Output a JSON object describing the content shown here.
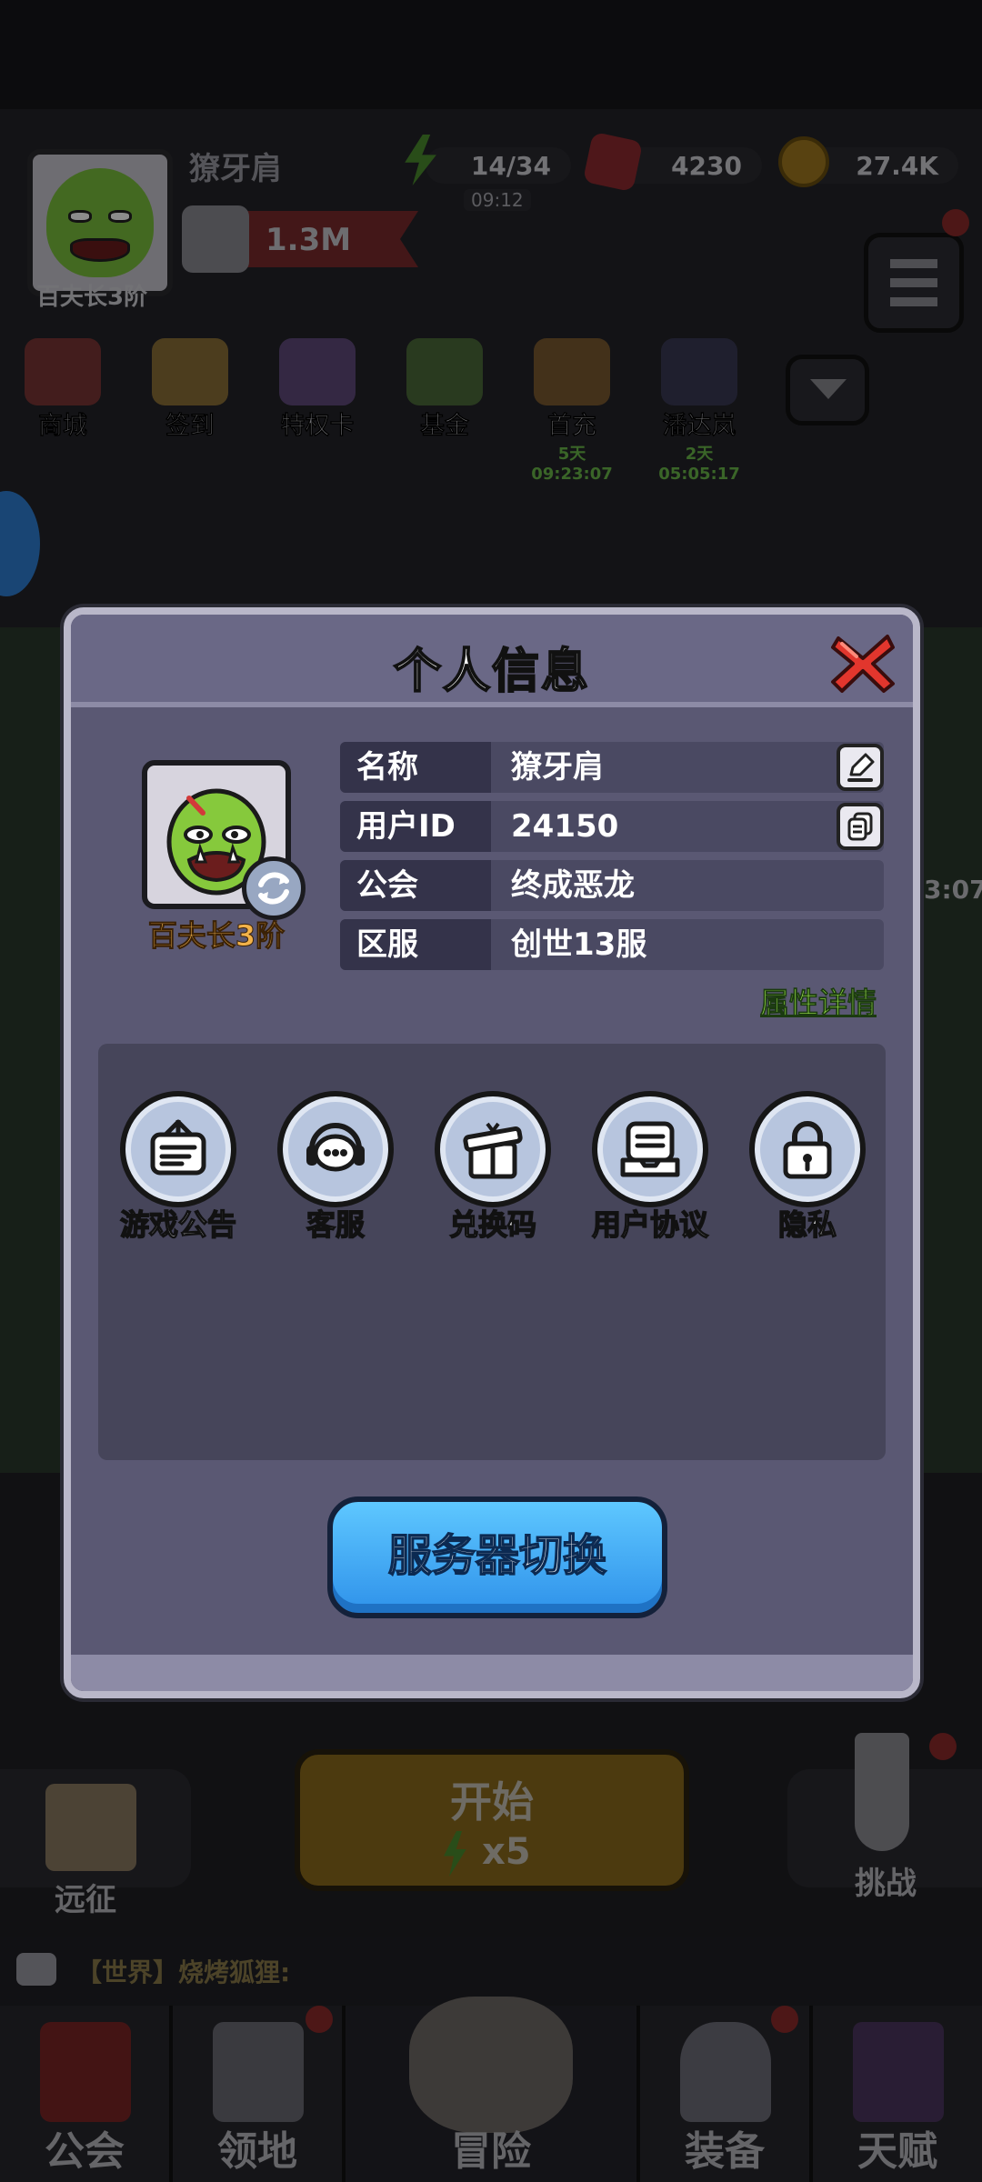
{
  "background": {
    "player_name": "獠牙肩",
    "rank": "百夫长3阶",
    "power": "1.3M",
    "energy": "14/34",
    "energy_timer": "09:12",
    "gems": "4230",
    "gold": "27.4K",
    "top_icons": [
      {
        "label": "商城",
        "timer": ""
      },
      {
        "label": "签到",
        "timer": ""
      },
      {
        "label": "特权卡",
        "timer": ""
      },
      {
        "label": "基金",
        "timer": ""
      },
      {
        "label": "首充",
        "timer": "5天09:23:07"
      },
      {
        "label": "潘达岚",
        "timer": "2天05:05:17"
      }
    ],
    "side_timer": "3:07",
    "start_button": "开始",
    "start_cost": "x5",
    "expedition": "远征",
    "challenge": "挑战",
    "chat_text": "【世界】烧烤狐狸:",
    "bottom_nav": [
      "公会",
      "领地",
      "冒险",
      "装备",
      "天赋"
    ]
  },
  "modal": {
    "title": "个人信息",
    "avatar_rank": "百夫长3阶",
    "rows": [
      {
        "key": "名称",
        "value": "獠牙肩"
      },
      {
        "key": "用户ID",
        "value": "24150"
      },
      {
        "key": "公会",
        "value": "终成恶龙"
      },
      {
        "key": "区服",
        "value": "创世13服"
      }
    ],
    "detail_link": "属性详情",
    "features": [
      "游戏公告",
      "客服",
      "兑换码",
      "用户协议",
      "隐私"
    ],
    "switch_button": "服务器切换"
  },
  "colors": {
    "modal_bg": "#5a5873",
    "accent_blue": "#2f92ea",
    "link_green": "#9be24b",
    "rank_orange": "#f2b24a",
    "close_red": "#e2362d"
  }
}
